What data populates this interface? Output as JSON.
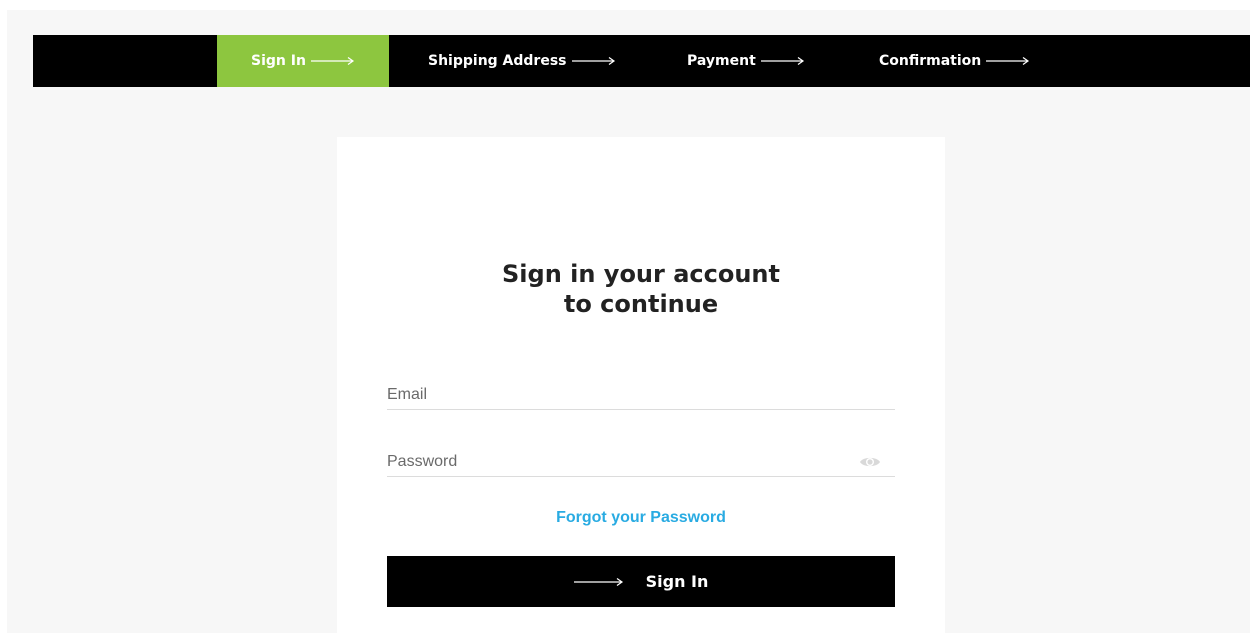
{
  "stepper": {
    "active_color": "#8dc63f",
    "steps": [
      {
        "label": "Sign In",
        "active": true
      },
      {
        "label": "Shipping Address",
        "active": false
      },
      {
        "label": "Payment",
        "active": false
      },
      {
        "label": "Confirmation",
        "active": false
      }
    ]
  },
  "form": {
    "heading_line1": "Sign in your account",
    "heading_line2": "to continue",
    "email_placeholder": "Email",
    "email_value": "",
    "password_placeholder": "Password",
    "password_value": "",
    "forgot_link": "Forgot your Password",
    "submit_label": "Sign In",
    "link_color": "#29abe2"
  },
  "icons": {
    "step_arrow": "long-arrow-right-icon",
    "password_toggle": "eye-icon",
    "button_arrow": "long-arrow-right-icon"
  }
}
